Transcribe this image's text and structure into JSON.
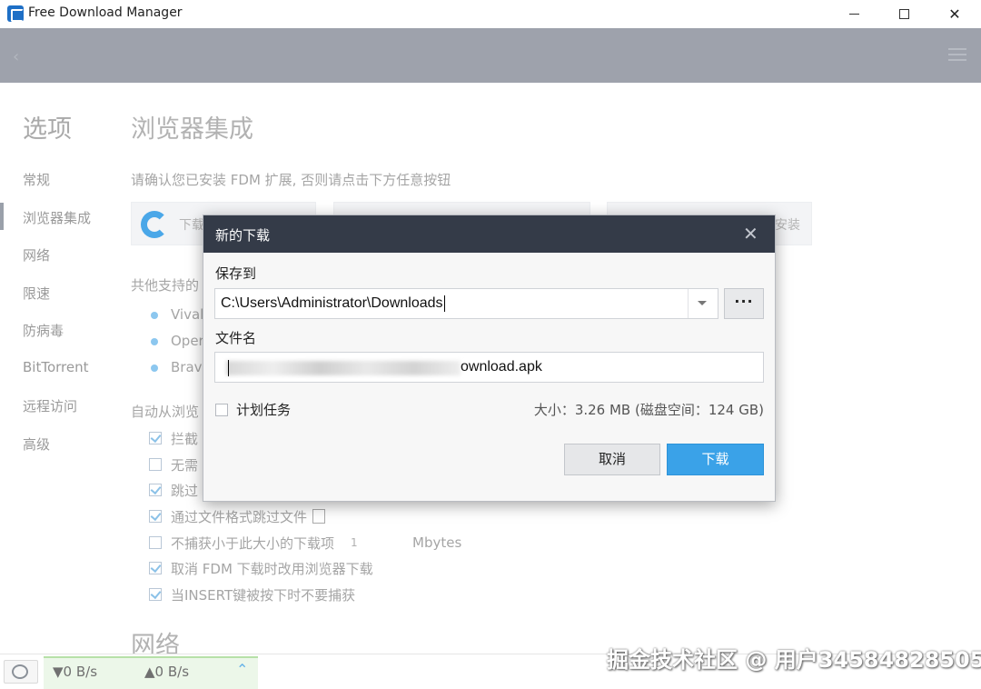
{
  "window": {
    "title": "Free Download Manager",
    "controls": {
      "minimize": "—",
      "maximize": "☐",
      "close": "✕"
    }
  },
  "header": {
    "back_icon": "arrow-left-icon",
    "menu_icon": "hamburger-menu-icon"
  },
  "sidebar": {
    "title": "选项",
    "items": [
      {
        "label": "常规"
      },
      {
        "label": "浏览器集成",
        "active": true
      },
      {
        "label": "网络"
      },
      {
        "label": "限速"
      },
      {
        "label": "防病毒"
      },
      {
        "label": "BitTorrent"
      },
      {
        "label": "远程访问"
      },
      {
        "label": "高级"
      }
    ]
  },
  "content": {
    "section_title": "浏览器集成",
    "install_prompt": "请确认您已安装 FDM 扩展, 否则请点击下方任意按钮",
    "extension_cards": [
      {
        "label": "下载",
        "icon": "edge-icon"
      },
      {
        "label": "",
        "icon": "firefox-icon"
      },
      {
        "label": "安装",
        "icon": "chrome-icon"
      }
    ],
    "other_browsers_label": "共他支持的",
    "other_browsers": [
      "Vival",
      "Oper",
      "Brav"
    ],
    "auto_capture_label": "自动从浏览",
    "options": [
      {
        "label": "拦截",
        "checked": true
      },
      {
        "label": "无需",
        "checked": false
      },
      {
        "label": "跳过",
        "checked": true
      },
      {
        "label": "通过文件格式跳过文件",
        "checked": true
      },
      {
        "label": "不捕获小于此大小的下载项",
        "checked": false,
        "value": "1",
        "unit": "Mbytes"
      },
      {
        "label": "取消 FDM 下载时改用浏览器下载",
        "checked": true
      },
      {
        "label": "当INSERT键被按下时不要捕获",
        "checked": true
      }
    ],
    "next_section_title": "网络"
  },
  "statusbar": {
    "snail_icon": "snail-icon",
    "download_speed": "▼0 B/s",
    "upload_speed": "▲0 B/s",
    "expand_icon": "chevron-up-icon"
  },
  "watermark": "掘金技术社区 @ 用户34584828505",
  "dialog": {
    "title": "新的下载",
    "close": "✕",
    "save_to_label": "保存到",
    "save_path": "C:\\Users\\Administrator\\Downloads",
    "browse_label": "···",
    "file_name_label": "文件名",
    "file_name_visible": "ownload.apk",
    "schedule_label": "计划任务",
    "size_info": "大小：3.26 MB (磁盘空间：124 GB)",
    "cancel_label": "取消",
    "download_label": "下载"
  }
}
